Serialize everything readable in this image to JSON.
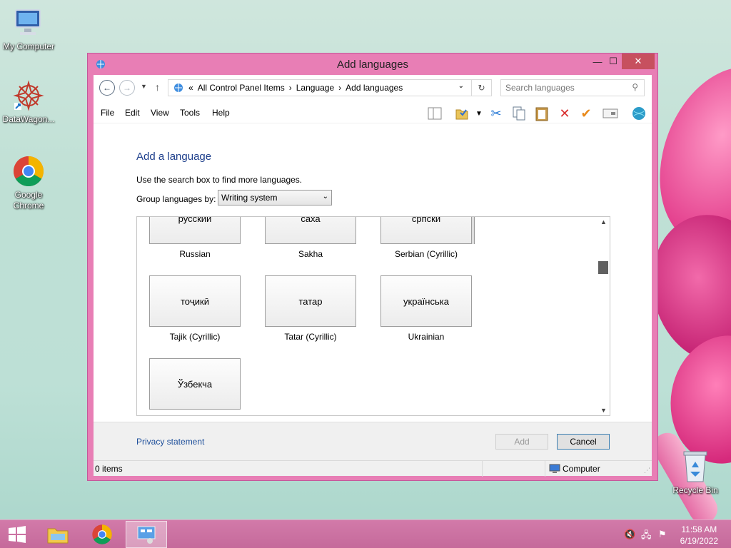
{
  "desktop": {
    "icons": [
      {
        "label": "My Computer",
        "icon": "computer-icon"
      },
      {
        "label": "DataWagon...",
        "icon": "datawagon-icon"
      },
      {
        "label": "Google Chrome",
        "icon": "chrome-icon"
      },
      {
        "label": "Recycle Bin",
        "icon": "recycle-bin-icon"
      }
    ]
  },
  "window": {
    "title": "Add languages"
  },
  "address": {
    "prefix": "«",
    "crumbs": [
      "All Control Panel Items",
      "Language",
      "Add languages"
    ]
  },
  "search": {
    "placeholder": "Search languages"
  },
  "menu": {
    "file": "File",
    "edit": "Edit",
    "view": "View",
    "tools": "Tools",
    "help": "Help"
  },
  "content": {
    "heading": "Add a language",
    "hint": "Use the search box to find more languages.",
    "group_label": "Group languages by:",
    "group_value": "Writing system"
  },
  "languages": [
    {
      "native": "русский",
      "name": "Russian"
    },
    {
      "native": "саха",
      "name": "Sakha"
    },
    {
      "native": "српски",
      "name": "Serbian (Cyrillic)"
    },
    {
      "native": "тоҷикӣ",
      "name": "Tajik (Cyrillic)"
    },
    {
      "native": "татар",
      "name": "Tatar (Cyrillic)"
    },
    {
      "native": "українська",
      "name": "Ukrainian"
    },
    {
      "native": "Ўзбекча",
      "name": ""
    }
  ],
  "footer": {
    "privacy": "Privacy statement",
    "add": "Add",
    "cancel": "Cancel"
  },
  "status": {
    "items": "0 items",
    "location": "Computer"
  },
  "taskbar": {
    "time": "11:58 AM",
    "date": "6/19/2022"
  },
  "colors": {
    "accent": "#e87eb5",
    "link": "#1e4f9b",
    "close": "#c7505f"
  }
}
